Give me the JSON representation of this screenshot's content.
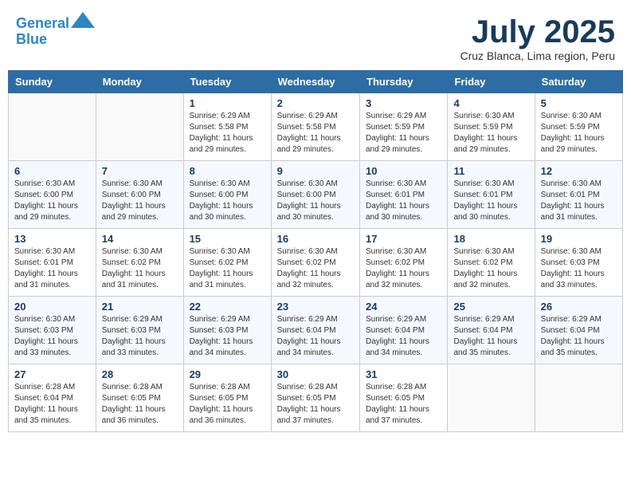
{
  "header": {
    "logo_line1": "General",
    "logo_line2": "Blue",
    "month": "July 2025",
    "location": "Cruz Blanca, Lima region, Peru"
  },
  "weekdays": [
    "Sunday",
    "Monday",
    "Tuesday",
    "Wednesday",
    "Thursday",
    "Friday",
    "Saturday"
  ],
  "weeks": [
    [
      {
        "day": "",
        "info": ""
      },
      {
        "day": "",
        "info": ""
      },
      {
        "day": "1",
        "info": "Sunrise: 6:29 AM\nSunset: 5:58 PM\nDaylight: 11 hours\nand 29 minutes."
      },
      {
        "day": "2",
        "info": "Sunrise: 6:29 AM\nSunset: 5:58 PM\nDaylight: 11 hours\nand 29 minutes."
      },
      {
        "day": "3",
        "info": "Sunrise: 6:29 AM\nSunset: 5:59 PM\nDaylight: 11 hours\nand 29 minutes."
      },
      {
        "day": "4",
        "info": "Sunrise: 6:30 AM\nSunset: 5:59 PM\nDaylight: 11 hours\nand 29 minutes."
      },
      {
        "day": "5",
        "info": "Sunrise: 6:30 AM\nSunset: 5:59 PM\nDaylight: 11 hours\nand 29 minutes."
      }
    ],
    [
      {
        "day": "6",
        "info": "Sunrise: 6:30 AM\nSunset: 6:00 PM\nDaylight: 11 hours\nand 29 minutes."
      },
      {
        "day": "7",
        "info": "Sunrise: 6:30 AM\nSunset: 6:00 PM\nDaylight: 11 hours\nand 29 minutes."
      },
      {
        "day": "8",
        "info": "Sunrise: 6:30 AM\nSunset: 6:00 PM\nDaylight: 11 hours\nand 30 minutes."
      },
      {
        "day": "9",
        "info": "Sunrise: 6:30 AM\nSunset: 6:00 PM\nDaylight: 11 hours\nand 30 minutes."
      },
      {
        "day": "10",
        "info": "Sunrise: 6:30 AM\nSunset: 6:01 PM\nDaylight: 11 hours\nand 30 minutes."
      },
      {
        "day": "11",
        "info": "Sunrise: 6:30 AM\nSunset: 6:01 PM\nDaylight: 11 hours\nand 30 minutes."
      },
      {
        "day": "12",
        "info": "Sunrise: 6:30 AM\nSunset: 6:01 PM\nDaylight: 11 hours\nand 31 minutes."
      }
    ],
    [
      {
        "day": "13",
        "info": "Sunrise: 6:30 AM\nSunset: 6:01 PM\nDaylight: 11 hours\nand 31 minutes."
      },
      {
        "day": "14",
        "info": "Sunrise: 6:30 AM\nSunset: 6:02 PM\nDaylight: 11 hours\nand 31 minutes."
      },
      {
        "day": "15",
        "info": "Sunrise: 6:30 AM\nSunset: 6:02 PM\nDaylight: 11 hours\nand 31 minutes."
      },
      {
        "day": "16",
        "info": "Sunrise: 6:30 AM\nSunset: 6:02 PM\nDaylight: 11 hours\nand 32 minutes."
      },
      {
        "day": "17",
        "info": "Sunrise: 6:30 AM\nSunset: 6:02 PM\nDaylight: 11 hours\nand 32 minutes."
      },
      {
        "day": "18",
        "info": "Sunrise: 6:30 AM\nSunset: 6:02 PM\nDaylight: 11 hours\nand 32 minutes."
      },
      {
        "day": "19",
        "info": "Sunrise: 6:30 AM\nSunset: 6:03 PM\nDaylight: 11 hours\nand 33 minutes."
      }
    ],
    [
      {
        "day": "20",
        "info": "Sunrise: 6:30 AM\nSunset: 6:03 PM\nDaylight: 11 hours\nand 33 minutes."
      },
      {
        "day": "21",
        "info": "Sunrise: 6:29 AM\nSunset: 6:03 PM\nDaylight: 11 hours\nand 33 minutes."
      },
      {
        "day": "22",
        "info": "Sunrise: 6:29 AM\nSunset: 6:03 PM\nDaylight: 11 hours\nand 34 minutes."
      },
      {
        "day": "23",
        "info": "Sunrise: 6:29 AM\nSunset: 6:04 PM\nDaylight: 11 hours\nand 34 minutes."
      },
      {
        "day": "24",
        "info": "Sunrise: 6:29 AM\nSunset: 6:04 PM\nDaylight: 11 hours\nand 34 minutes."
      },
      {
        "day": "25",
        "info": "Sunrise: 6:29 AM\nSunset: 6:04 PM\nDaylight: 11 hours\nand 35 minutes."
      },
      {
        "day": "26",
        "info": "Sunrise: 6:29 AM\nSunset: 6:04 PM\nDaylight: 11 hours\nand 35 minutes."
      }
    ],
    [
      {
        "day": "27",
        "info": "Sunrise: 6:28 AM\nSunset: 6:04 PM\nDaylight: 11 hours\nand 35 minutes."
      },
      {
        "day": "28",
        "info": "Sunrise: 6:28 AM\nSunset: 6:05 PM\nDaylight: 11 hours\nand 36 minutes."
      },
      {
        "day": "29",
        "info": "Sunrise: 6:28 AM\nSunset: 6:05 PM\nDaylight: 11 hours\nand 36 minutes."
      },
      {
        "day": "30",
        "info": "Sunrise: 6:28 AM\nSunset: 6:05 PM\nDaylight: 11 hours\nand 37 minutes."
      },
      {
        "day": "31",
        "info": "Sunrise: 6:28 AM\nSunset: 6:05 PM\nDaylight: 11 hours\nand 37 minutes."
      },
      {
        "day": "",
        "info": ""
      },
      {
        "day": "",
        "info": ""
      }
    ]
  ]
}
